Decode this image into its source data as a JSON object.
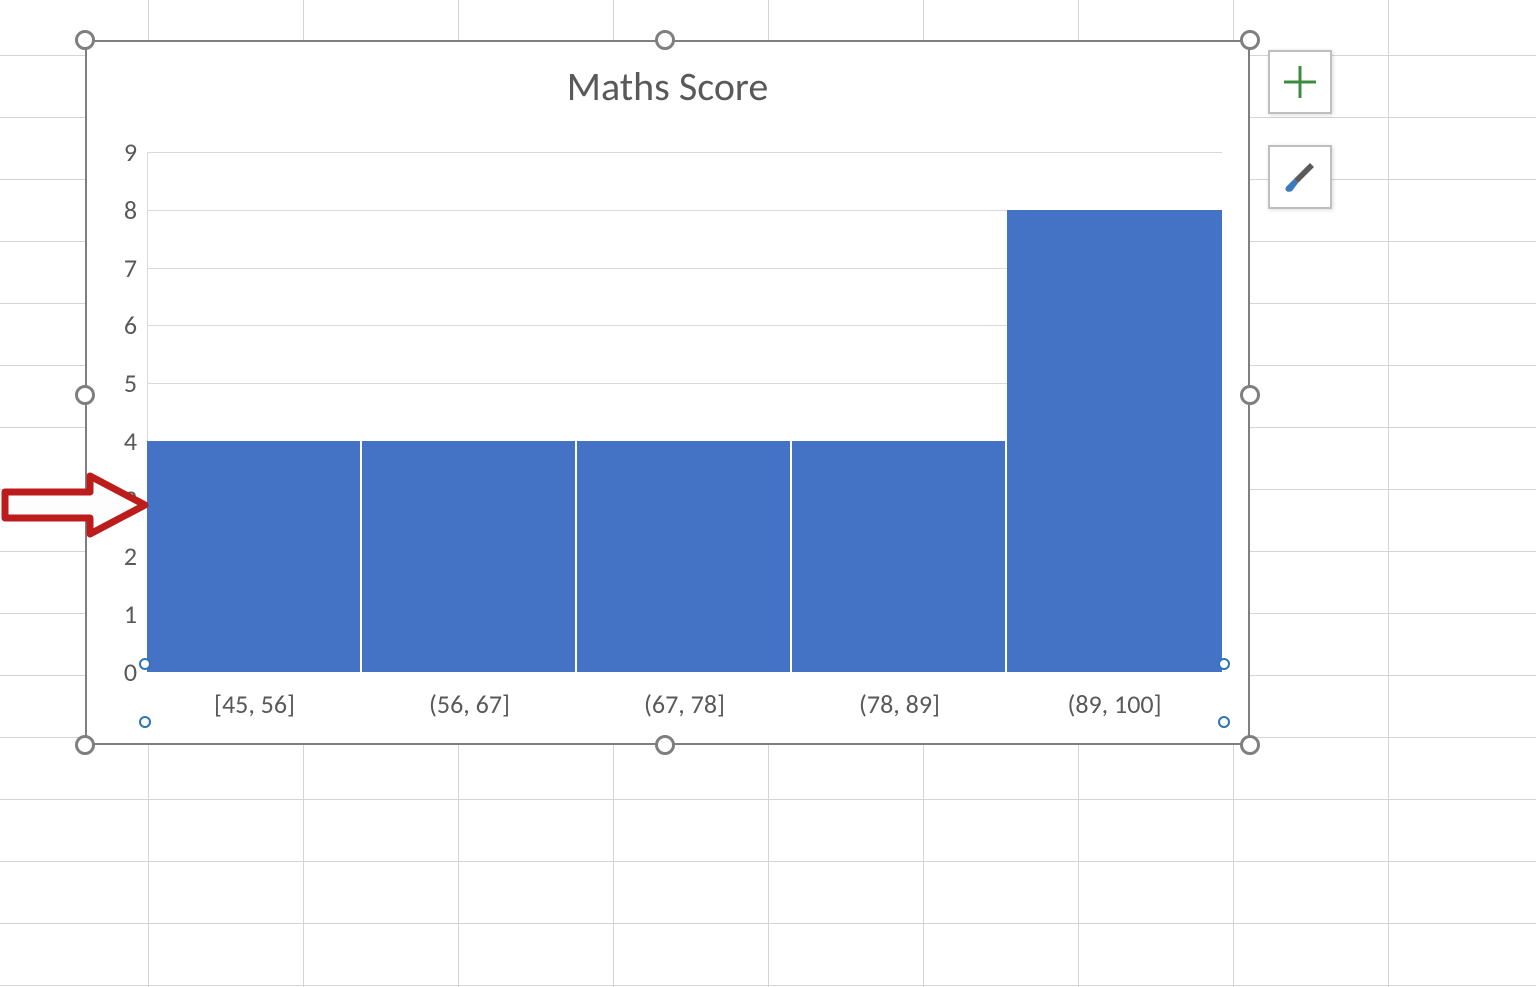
{
  "chart_data": {
    "type": "bar",
    "title": "Maths Score",
    "categories": [
      "[45, 56]",
      "(56, 67]",
      "(67, 78]",
      "(78, 89]",
      "(89, 100]"
    ],
    "values": [
      4,
      4,
      4,
      4,
      8
    ],
    "xlabel": "",
    "ylabel": "",
    "ylim": [
      0,
      9
    ],
    "yticks": [
      0,
      1,
      2,
      3,
      4,
      5,
      6,
      7,
      8,
      9
    ]
  },
  "side_buttons": {
    "add_element": "Chart Elements",
    "style": "Chart Styles"
  },
  "annotation": {
    "arrow_points_to": "y-axis value 3"
  },
  "colors": {
    "bar_fill": "#4472c4",
    "grid": "#d9d9d9",
    "text": "#595959",
    "selection_handle": "#7f7f7f",
    "axis_selection": "#2e75b6",
    "plus_icon": "#3c8c40",
    "arrow": "#bc1c1c"
  }
}
